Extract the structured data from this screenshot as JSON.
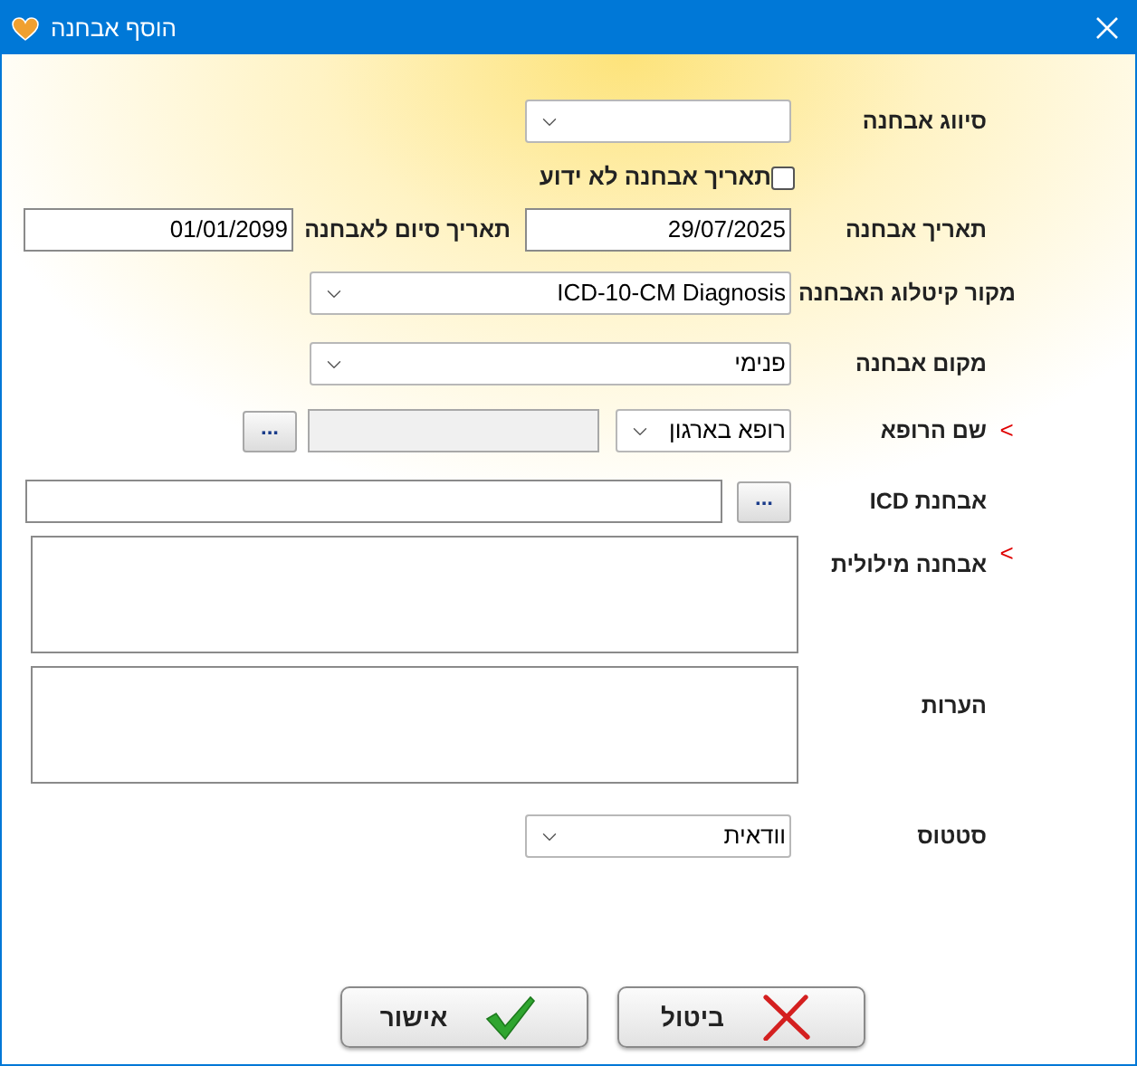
{
  "window": {
    "title": "הוסף אבחנה"
  },
  "classification": {
    "label": "סיווג אבחנה"
  },
  "unknown_date": {
    "label": "תאריך אבחנה לא ידוע",
    "checked": false
  },
  "diagnosis_date": {
    "label": "תאריך אבחנה",
    "value": "29/07/2025"
  },
  "end_date": {
    "label": "תאריך סיום לאבחנה",
    "value": "01/01/2099"
  },
  "catalog_source": {
    "label": "מקור קיטלוג האבחנה",
    "value": "ICD-10-CM Diagnosis"
  },
  "diagnosis_place": {
    "label": "מקום אבחנה",
    "value": "פנימי"
  },
  "doctor": {
    "required_mark": "<",
    "label": "שם הרופא",
    "value": "רופא בארגון",
    "browse_button": "..."
  },
  "icd": {
    "label": "אבחנת ICD",
    "browse_button": "..."
  },
  "verbal_diagnosis": {
    "required_mark": "<",
    "label": "אבחנה מילולית"
  },
  "notes": {
    "label": "הערות"
  },
  "status": {
    "label": "סטטוס",
    "value": "וודאית"
  },
  "buttons": [
    {
      "label": "ביטול",
      "kind": "cancel"
    },
    {
      "label": "אישור",
      "kind": "ok"
    }
  ]
}
